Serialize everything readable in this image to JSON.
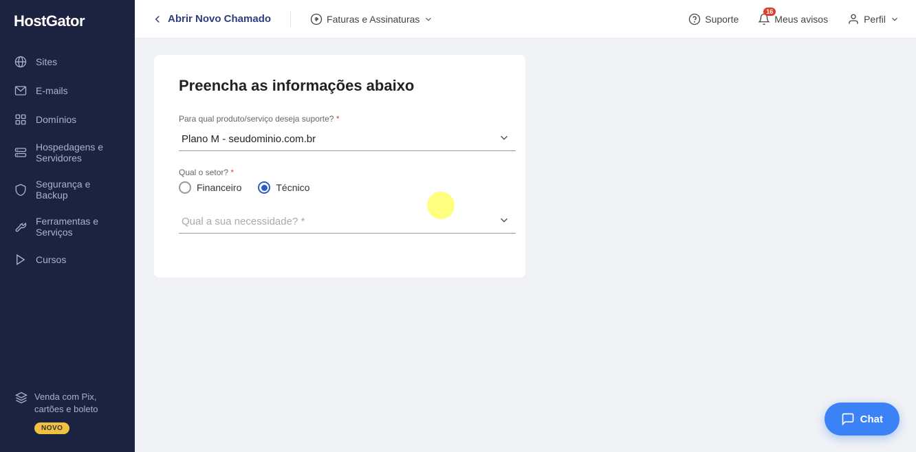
{
  "sidebar": {
    "logo": "HostGator",
    "items": [
      {
        "id": "sites",
        "label": "Sites",
        "icon": "globe"
      },
      {
        "id": "emails",
        "label": "E-mails",
        "icon": "mail"
      },
      {
        "id": "dominios",
        "label": "Domínios",
        "icon": "grid"
      },
      {
        "id": "hospedagens",
        "label": "Hospedagens e Servidores",
        "icon": "server"
      },
      {
        "id": "seguranca",
        "label": "Segurança e Backup",
        "icon": "shield"
      },
      {
        "id": "ferramentas",
        "label": "Ferramentas e Serviços",
        "icon": "tool"
      },
      {
        "id": "cursos",
        "label": "Cursos",
        "icon": "play"
      }
    ],
    "promo": {
      "title": "Venda com Pix, cartões e boleto",
      "badge": "NOVO"
    }
  },
  "topnav": {
    "back_label": "Abrir Novo Chamado",
    "menu_label": "Faturas e Assinaturas",
    "support_label": "Suporte",
    "notifications_label": "Meus avisos",
    "notifications_count": "16",
    "profile_label": "Perfil"
  },
  "form": {
    "title": "Preencha as informações abaixo",
    "product_label": "Para qual produto/serviço deseja suporte?",
    "product_required": "*",
    "product_value": "Plano M - seudominio.com.br",
    "sector_label": "Qual o setor?",
    "sector_required": "*",
    "sector_options": [
      {
        "id": "financeiro",
        "label": "Financeiro",
        "checked": false
      },
      {
        "id": "tecnico",
        "label": "Técnico",
        "checked": true
      }
    ],
    "necessity_label": "Qual a sua necessidade?",
    "necessity_required": "*",
    "necessity_placeholder": "Qual a sua necessidade? *"
  },
  "chat": {
    "label": "Chat"
  }
}
